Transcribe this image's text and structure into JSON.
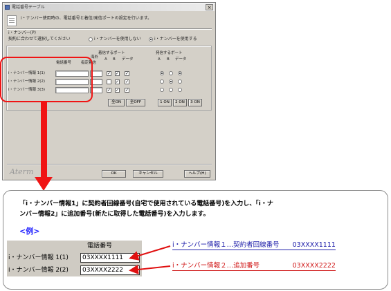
{
  "window": {
    "title": "電話番号テーブル",
    "close_glyph": "×",
    "description": "i・ナンバー使用時の、電話番号と着信/発信ポートの設定を行います。",
    "group_label": "i・ナンバー(P)",
    "group_hint": "契約に合わせて選択してください",
    "radio_no": "i・ナンバーを使用しない",
    "radio_yes": "i・ナンバーを使用する",
    "radio_selected": "yes",
    "col_phone": "電話番号",
    "col_designate": "指定着信",
    "col_overseas": "海外",
    "col_incoming": "着信するポート",
    "col_outgoing": "発信するポート",
    "port_a": "A",
    "port_b": "B",
    "port_data": "データ",
    "rows": [
      {
        "label": "i・ナンバー情報 1(1)",
        "phone": "",
        "designate": "",
        "in": [
          true,
          true,
          true
        ],
        "out": [
          "on",
          "off",
          "on"
        ]
      },
      {
        "label": "i・ナンバー情報 2(2)",
        "phone": "",
        "designate": "",
        "in": [
          false,
          true,
          true
        ],
        "out": [
          "off",
          "on",
          "off"
        ]
      },
      {
        "label": "i・ナンバー情報 3(3)",
        "phone": "",
        "designate": "",
        "in": [
          true,
          true,
          true
        ],
        "out": [
          "off",
          "off",
          "off"
        ]
      }
    ],
    "btn_all_on": "全ON",
    "btn_all_off": "全OFF",
    "btn_1on": "1 ON",
    "btn_2on": "2 ON",
    "btn_3on": "3 ON",
    "logo": "Aterm",
    "btn_ok": "OK",
    "btn_cancel": "キャンセル",
    "btn_help": "ヘルプ(H)"
  },
  "explanation": {
    "line1": "「i・ナンバー情報1」に契約者回線番号(自宅で使用されている電話番号)を入力し、「i・ナ",
    "line2": "ンバー情報2」に追加番号(新たに取得した電話番号)を入力します。",
    "example_heading": "<例>",
    "table_header": "電話番号",
    "rows": [
      {
        "label": "i・ナンバー情報 1(1)",
        "value": "03XXXX1111"
      },
      {
        "label": "i・ナンバー情報 2(2)",
        "value": "03XXXX2222"
      }
    ],
    "note1": "i・ナンバー情報１…契約者回線番号　　03XXXX1111",
    "note2": "i・ナンバー情報２…追加番号　　　　　03XXXX2222",
    "note1_color": "#1a1aa8",
    "note2_color": "#d01818",
    "highlight_color": "#f01414"
  }
}
